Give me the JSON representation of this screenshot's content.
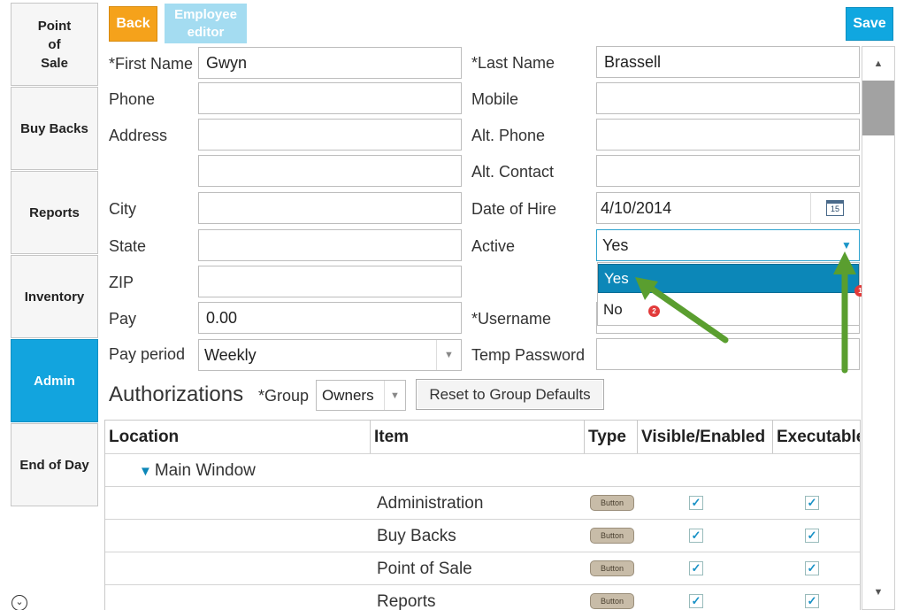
{
  "sidebar": {
    "items": [
      {
        "label": "Point\nof\nSale"
      },
      {
        "label": "Buy Backs"
      },
      {
        "label": "Reports"
      },
      {
        "label": "Inventory"
      },
      {
        "label": "Admin"
      },
      {
        "label": "End of Day"
      }
    ]
  },
  "toolbar": {
    "back_label": "Back",
    "editor_label": "Employee\neditor",
    "save_label": "Save"
  },
  "form": {
    "first_name_label": "*First Name",
    "first_name_value": "Gwyn",
    "last_name_label": "*Last Name",
    "last_name_value": "Brassell",
    "phone_label": "Phone",
    "mobile_label": "Mobile",
    "address_label": "Address",
    "alt_phone_label": "Alt. Phone",
    "alt_contact_label": "Alt. Contact",
    "city_label": "City",
    "date_of_hire_label": "Date of Hire",
    "date_of_hire_value": "4/10/2014",
    "calendar_day": "15",
    "state_label": "State",
    "active_label": "Active",
    "active_value": "Yes",
    "active_options": [
      "Yes",
      "No"
    ],
    "zip_label": "ZIP",
    "pay_label": "Pay",
    "pay_value": "0.00",
    "username_label": "*Username",
    "pay_period_label": "Pay period",
    "pay_period_value": "Weekly",
    "temp_password_label": "Temp Password",
    "badge_1": "1",
    "badge_2": "2"
  },
  "authorizations": {
    "title": "Authorizations",
    "group_label": "*Group",
    "group_value": "Owners",
    "reset_label": "Reset to Group Defaults",
    "columns": [
      "Location",
      "Item",
      "Type",
      "Visible/Enabled",
      "Executable"
    ],
    "group_row": "Main Window",
    "rows": [
      {
        "item": "Administration",
        "type": "Button",
        "visible": true,
        "executable": true
      },
      {
        "item": "Buy Backs",
        "type": "Button",
        "visible": true,
        "executable": true
      },
      {
        "item": "Point of Sale",
        "type": "Button",
        "visible": true,
        "executable": true
      },
      {
        "item": "Reports",
        "type": "Button",
        "visible": true,
        "executable": true
      }
    ]
  },
  "colors": {
    "accent": "#12a4de",
    "back": "#f5a21b",
    "selected_option": "#0c87b8",
    "arrow": "#5a9e2f"
  }
}
